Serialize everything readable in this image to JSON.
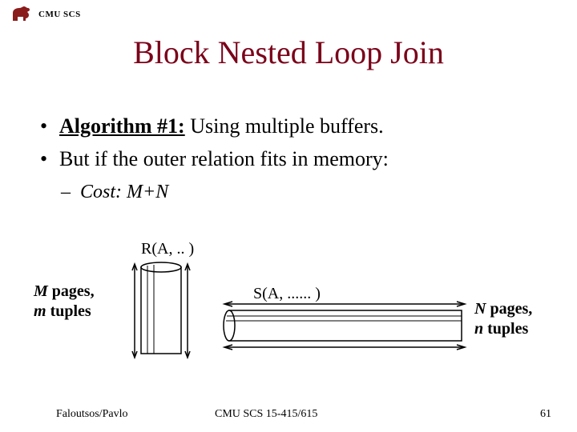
{
  "header": {
    "org": "CMU SCS"
  },
  "title": "Block Nested Loop Join",
  "bullets": {
    "items": [
      {
        "strong": "Algorithm #1:",
        "rest": " Using multiple buffers."
      },
      {
        "strong": "",
        "rest": "But if the outer relation fits in memory:"
      }
    ],
    "sub": "Cost: M+N"
  },
  "diagram": {
    "r_label": "R(A, .. )",
    "s_label": "S(A, ...... )",
    "m_label": {
      "line1_var": "M",
      "line1_rest": " pages,",
      "line2_var": "m",
      "line2_rest": " tuples"
    },
    "n_label": {
      "line1_var": "N",
      "line1_rest": " pages,",
      "line2_var": "n",
      "line2_rest": " tuples"
    }
  },
  "footer": {
    "left": "Faloutsos/Pavlo",
    "center": "CMU SCS 15-415/615",
    "page": "61"
  }
}
